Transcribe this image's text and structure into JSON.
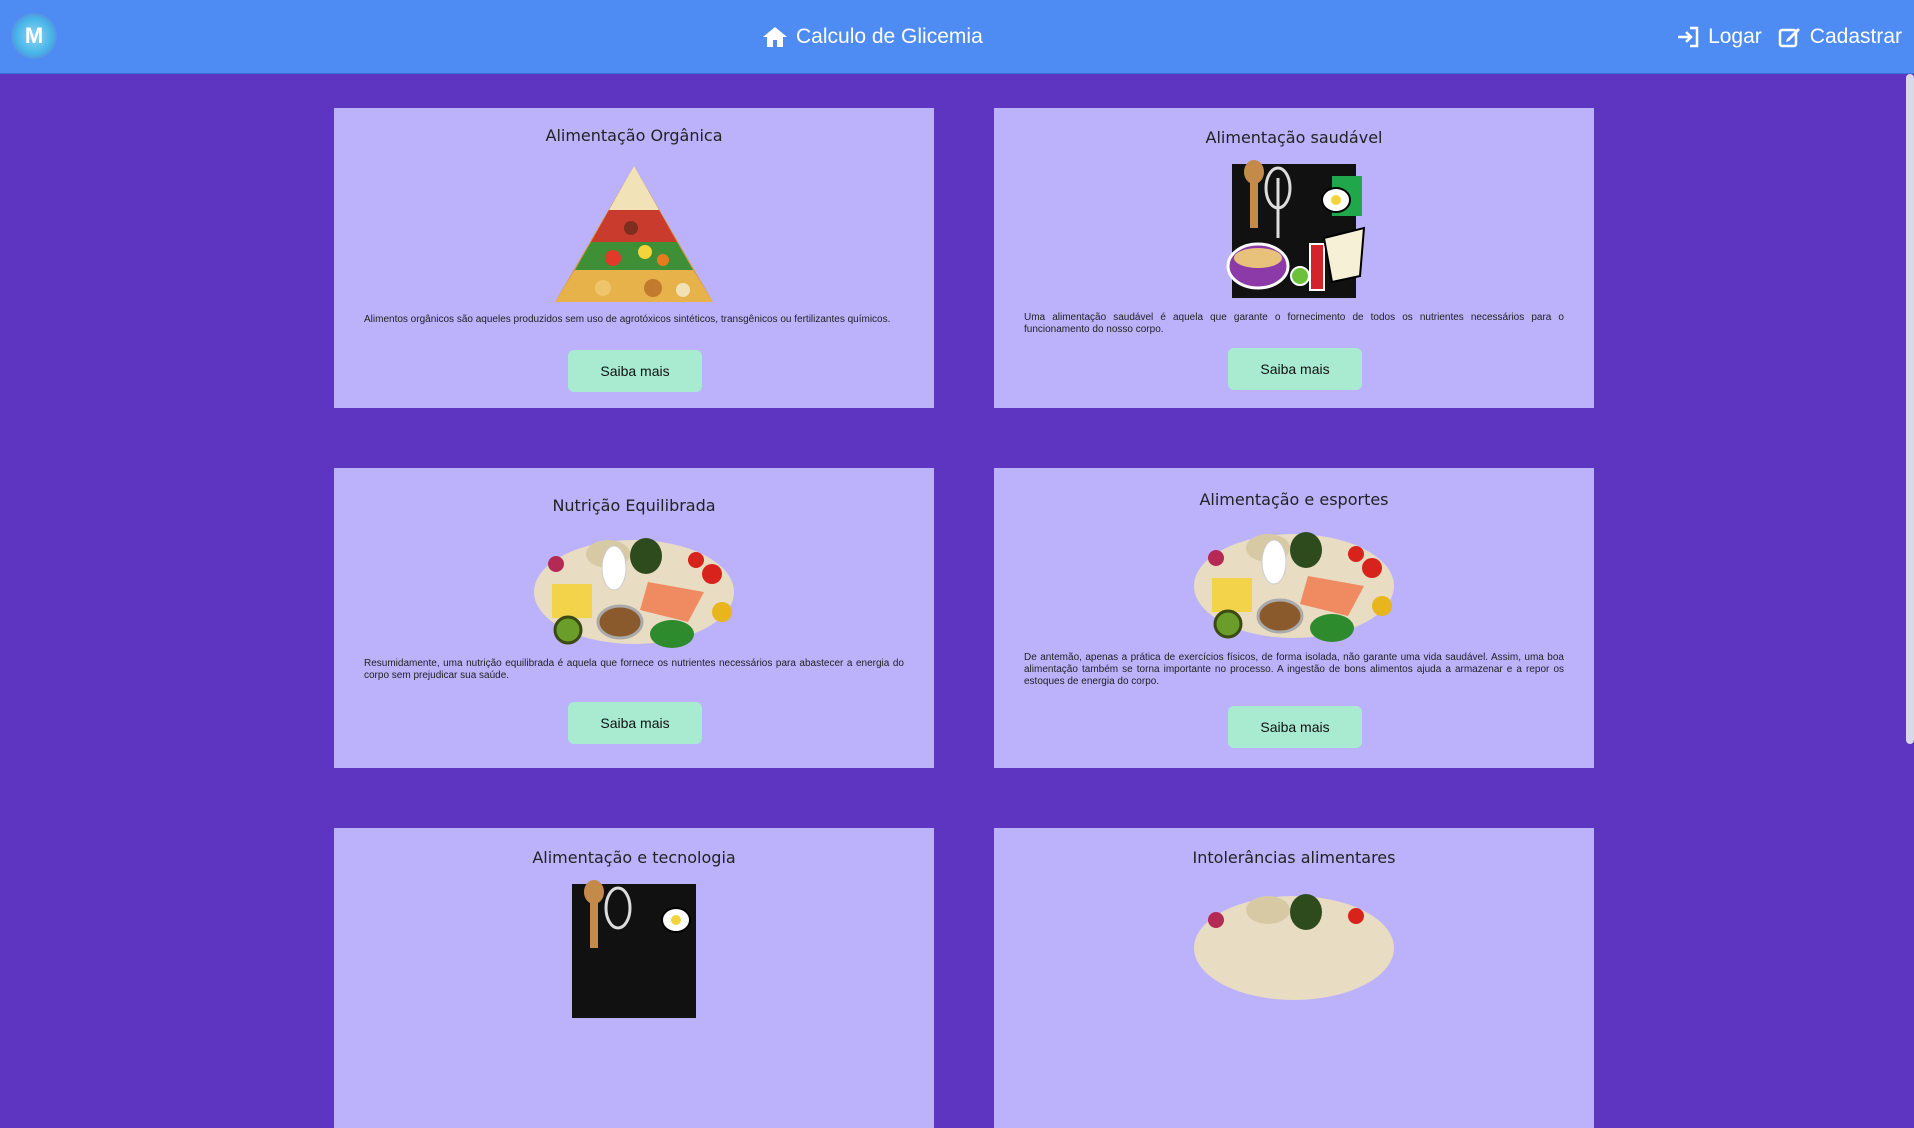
{
  "navbar": {
    "logo_letter": "M",
    "title": "Calculo de Glicemia",
    "login": "Logar",
    "register": "Cadastrar"
  },
  "cards": [
    {
      "title": "Alimentação Orgânica",
      "text": "Alimentos orgânicos são aqueles produzidos sem uso de agrotóxicos sintéticos, transgênicos ou fertilizantes químicos.",
      "button": "Saiba mais",
      "image": "food-pyramid"
    },
    {
      "title": "Alimentação saudável",
      "text": "Uma alimentação saudável é aquela que garante o fornecimento de todos os nutrientes necessários para o funcionamento do nosso corpo.",
      "button": "Saiba mais",
      "image": "kitchen-clipart"
    },
    {
      "title": "Nutrição Equilibrada",
      "text": "Resumidamente, uma nutrição equilibrada é aquela que fornece os nutrientes necessários para abastecer a energia do corpo sem prejudicar sua saúde.",
      "button": "Saiba mais",
      "image": "healthy-food-spread"
    },
    {
      "title": "Alimentação e esportes",
      "text": "De antemão, apenas a prática de exercícios físicos, de forma isolada, não garante uma vida saudável. Assim, uma boa alimentação também se torna importante no processo. A ingestão de bons alimentos ajuda a armazenar e a repor os estoques de energia do corpo.",
      "button": "Saiba mais",
      "image": "healthy-food-spread"
    },
    {
      "title": "Alimentação e tecnologia",
      "image": "kitchen-clipart"
    },
    {
      "title": "Intolerâncias alimentares",
      "image": "healthy-food-spread"
    }
  ]
}
